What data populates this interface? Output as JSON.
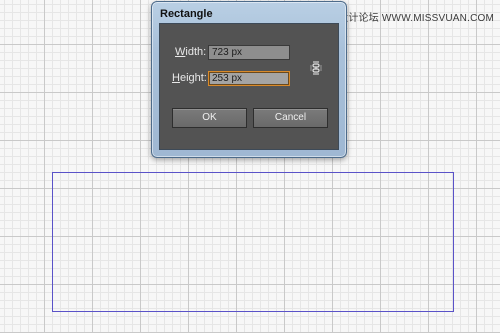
{
  "watermark": "思缘设计论坛  WWW.MISSVUAN.COM",
  "dialog": {
    "title": "Rectangle",
    "width": {
      "label_accel": "W",
      "label_rest": "idth:",
      "value": "723 px"
    },
    "height": {
      "label_accel": "H",
      "label_rest": "eight:",
      "value": "253 px"
    },
    "ok_label": "OK",
    "cancel_label": "Cancel",
    "link_icon": "chain-link-icon"
  },
  "colors": {
    "rectangle_stroke": "#5a52c8",
    "dialog_body": "#535353",
    "focus_ring": "#d98a2a"
  }
}
